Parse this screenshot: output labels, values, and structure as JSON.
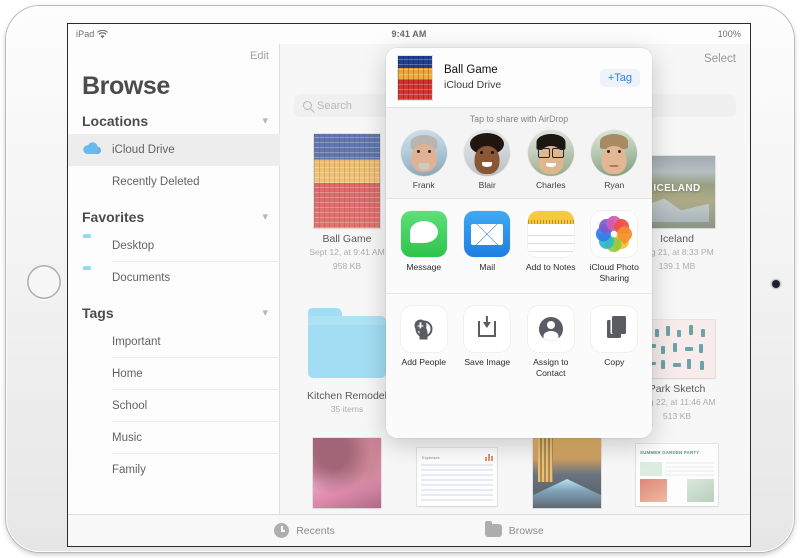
{
  "status_bar": {
    "device_label": "iPad",
    "wifi_icon": "wifi-icon",
    "time": "9:41 AM",
    "battery": "100%"
  },
  "sidebar": {
    "edit_label": "Edit",
    "title": "Browse",
    "sections": [
      {
        "title": "Locations",
        "chevron": "chevron-down-icon",
        "items": [
          {
            "label": "iCloud Drive",
            "icon": "icloud-icon",
            "selected": true
          },
          {
            "label": "Recently Deleted",
            "icon": "trash-icon",
            "selected": false
          }
        ]
      },
      {
        "title": "Favorites",
        "chevron": "chevron-down-icon",
        "items": [
          {
            "label": "Desktop",
            "icon": "folder-icon",
            "selected": false
          },
          {
            "label": "Documents",
            "icon": "folder-icon",
            "selected": false
          }
        ]
      },
      {
        "title": "Tags",
        "chevron": "chevron-down-icon",
        "items": [
          {
            "label": "Important",
            "icon": "tag-dot-icon",
            "color": "#f03b33",
            "selected": false
          },
          {
            "label": "Home",
            "icon": "tag-dot-icon",
            "color": "#f39019",
            "selected": false
          },
          {
            "label": "School",
            "icon": "tag-dot-icon",
            "color": "#f6ca21",
            "selected": false
          },
          {
            "label": "Music",
            "icon": "tag-dot-icon",
            "color": "#28c846",
            "selected": false
          },
          {
            "label": "Family",
            "icon": "tag-dot-icon",
            "color": "#1372ec",
            "selected": false
          }
        ]
      }
    ]
  },
  "content": {
    "select_label": "Select",
    "search_placeholder": "Search",
    "search_value": "",
    "files": [
      {
        "name": "Ball Game",
        "date": "Sept 12, at 9:41 AM",
        "size": "958 KB",
        "kind": "image"
      },
      {
        "name": "Iceland",
        "date": "Aug 21, at 8:33 PM",
        "size": "139.1 MB",
        "kind": "image"
      },
      {
        "name": "Kitchen Remodel",
        "date": "",
        "size": "35 items",
        "kind": "folder"
      },
      {
        "name": "Park Sketch",
        "date": "Aug 22, at 11:46 AM",
        "size": "513 KB",
        "kind": "image"
      }
    ]
  },
  "tab_bar": {
    "tabs": [
      {
        "label": "Recents",
        "icon": "clock-icon",
        "active": false
      },
      {
        "label": "Browse",
        "icon": "folder-icon",
        "active": true
      }
    ]
  },
  "share_sheet": {
    "file_title": "Ball Game",
    "file_location": "iCloud Drive",
    "tag_button": "+Tag",
    "airdrop_hint": "Tap to share with AirDrop",
    "airdrop_contacts": [
      {
        "name": "Frank"
      },
      {
        "name": "Blair"
      },
      {
        "name": "Charles"
      },
      {
        "name": "Ryan"
      }
    ],
    "apps": [
      {
        "label": "Message",
        "icon": "messages-app-icon"
      },
      {
        "label": "Mail",
        "icon": "mail-app-icon"
      },
      {
        "label": "Add to Notes",
        "icon": "notes-app-icon"
      },
      {
        "label": "iCloud Photo Sharing",
        "icon": "photos-app-icon"
      }
    ],
    "actions": [
      {
        "label": "Add People",
        "icon": "add-person-icon"
      },
      {
        "label": "Save Image",
        "icon": "download-icon"
      },
      {
        "label": "Assign to Contact",
        "icon": "contact-icon"
      },
      {
        "label": "Copy",
        "icon": "copy-icon"
      }
    ]
  },
  "theme": {
    "accent": "#2f7ef0",
    "folder_blue": "#7fd2f2",
    "selected_row": "#e8e8e8"
  }
}
